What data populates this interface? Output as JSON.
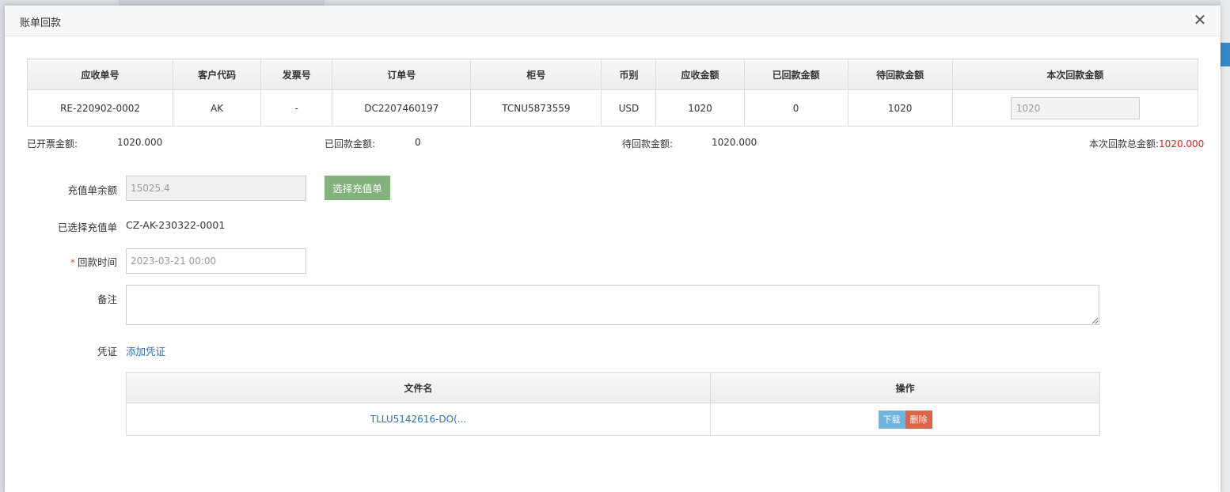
{
  "dialog": {
    "title": "账单回款"
  },
  "bill_table": {
    "headers": [
      "应收单号",
      "客户代码",
      "发票号",
      "订单号",
      "柜号",
      "币别",
      "应收金额",
      "已回款金额",
      "待回款金额",
      "本次回款金额"
    ],
    "row": {
      "receivable_no": "RE-220902-0002",
      "customer_code": "AK",
      "invoice_no": "-",
      "order_no": "DC2207460197",
      "container_no": "TCNU5873559",
      "currency": "USD",
      "receivable_amount": "1020",
      "received_amount": "0",
      "pending_amount": "1020",
      "this_amount": "1020"
    }
  },
  "summary": {
    "invoiced_label": "已开票金额:",
    "invoiced_value": "1020.000",
    "received_label": "已回款金额:",
    "received_value": "0",
    "pending_label": "待回款金额:",
    "pending_value": "1020.000",
    "total_label": "本次回款总金额:",
    "total_value": "1020.000"
  },
  "form": {
    "balance_label": "充值单余额",
    "balance_value": "15025.4",
    "select_button": "选择充值单",
    "selected_label": "已选择充值单",
    "selected_value": "CZ-AK-230322-0001",
    "required_mark": "*",
    "date_label": "回款时间",
    "date_value": "2023-03-21 00:00",
    "remark_label": "备注",
    "remark_value": "",
    "voucher_label": "凭证",
    "add_voucher_link": "添加凭证"
  },
  "file_table": {
    "headers": [
      "文件名",
      "操作"
    ],
    "rows": [
      {
        "file_name": "TLLU5142616-DO(...",
        "download": "下载",
        "delete": "删除"
      }
    ]
  },
  "colors": {
    "accent_green": "#81b37a",
    "link_blue": "#2f6fab",
    "total_red": "#e02020",
    "download_blue": "#6fb3e0",
    "delete_red": "#d9664a"
  }
}
